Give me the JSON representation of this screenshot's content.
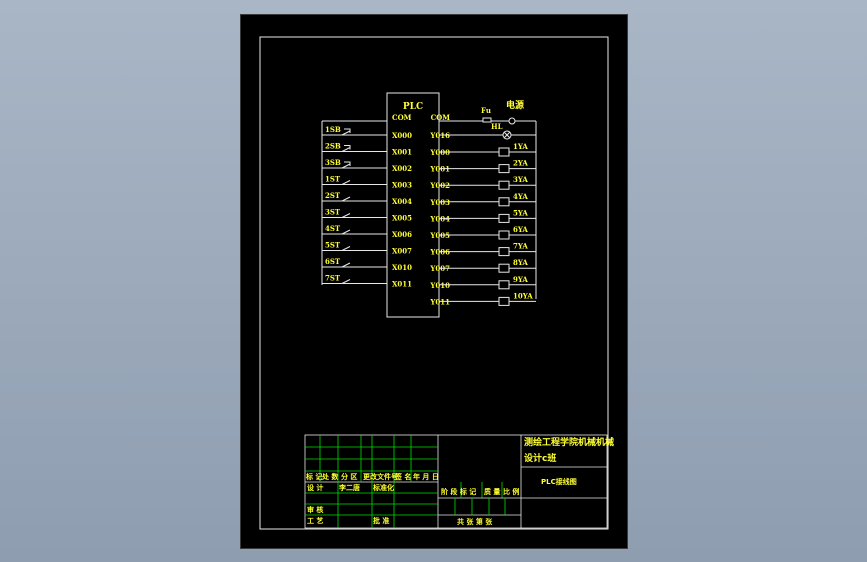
{
  "plc": {
    "label": "PLC",
    "input_com": "COM",
    "output_com": "COM",
    "inputs": [
      "X000",
      "X001",
      "X002",
      "X003",
      "X004",
      "X005",
      "X006",
      "X007",
      "X010",
      "X011"
    ],
    "outputs": [
      "Y016",
      "Y000",
      "Y001",
      "Y002",
      "Y003",
      "Y004",
      "Y005",
      "Y006",
      "Y007",
      "Y010",
      "Y011"
    ]
  },
  "input_devices": [
    "1SB",
    "2SB",
    "3SB",
    "1ST",
    "2ST",
    "3ST",
    "4ST",
    "5ST",
    "6ST",
    "7ST"
  ],
  "output_devices": [
    "1YA",
    "2YA",
    "3YA",
    "4YA",
    "5YA",
    "6YA",
    "7YA",
    "8YA",
    "9YA",
    "10YA"
  ],
  "fuse_label": "Fu",
  "lamp_label": "HL",
  "power_label": "电源",
  "title_block": {
    "school": "测绘工程学院机械机械",
    "course": "设计c班",
    "drawing_name": "PLC接线图",
    "header_cells": [
      "标 记",
      "处 数",
      "分 区",
      "更改文件号",
      "签 名",
      "年 月 日"
    ],
    "design_label": "设 计",
    "design_value": "李二唐",
    "standard_label": "标准化",
    "review_label": "审 核",
    "process_label": "工 艺",
    "approve_label": "批 准",
    "stage_labels": [
      "阶 段 标 记",
      "质 量",
      "比 例"
    ],
    "sheet_info": "共 张 第 张"
  }
}
